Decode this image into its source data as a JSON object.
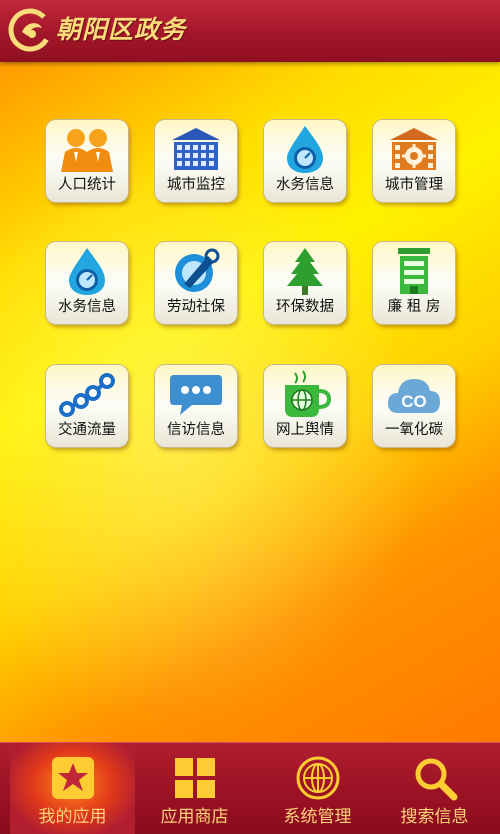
{
  "header": {
    "title": "朝阳区政务",
    "logo_icon": "chaoyang-logo-icon"
  },
  "apps": [
    {
      "label": "人口统计",
      "icon": "population-people-icon"
    },
    {
      "label": "城市监控",
      "icon": "city-monitor-building-icon"
    },
    {
      "label": "水务信息",
      "icon": "water-drop-gauge-icon"
    },
    {
      "label": "城市管理",
      "icon": "city-management-gear-building-icon"
    },
    {
      "label": "水务信息",
      "icon": "water-drop-gauge-icon"
    },
    {
      "label": "劳动社保",
      "icon": "labor-insurance-tool-icon"
    },
    {
      "label": "环保数据",
      "icon": "pine-tree-icon"
    },
    {
      "label": "廉 租 房",
      "icon": "low-rent-housing-icon"
    },
    {
      "label": "交通流量",
      "icon": "traffic-flow-nodes-icon"
    },
    {
      "label": "信访信息",
      "icon": "speech-bubble-icon"
    },
    {
      "label": "网上舆情",
      "icon": "globe-cup-icon"
    },
    {
      "label": "一氧化碳",
      "icon": "co-cloud-icon"
    }
  ],
  "tabbar": {
    "items": [
      {
        "label": "我的应用",
        "icon": "star-icon",
        "active": true
      },
      {
        "label": "应用商店",
        "icon": "grid-icon",
        "active": false
      },
      {
        "label": "系统管理",
        "icon": "globe-settings-icon",
        "active": false
      },
      {
        "label": "搜索信息",
        "icon": "search-icon",
        "active": false
      }
    ]
  },
  "colors": {
    "header_red": "#a3162a",
    "title_gold": "#f8dd7a",
    "background_yellow": "#fff100",
    "background_orange": "#ff7a00",
    "tab_label": "#ffd27a"
  }
}
